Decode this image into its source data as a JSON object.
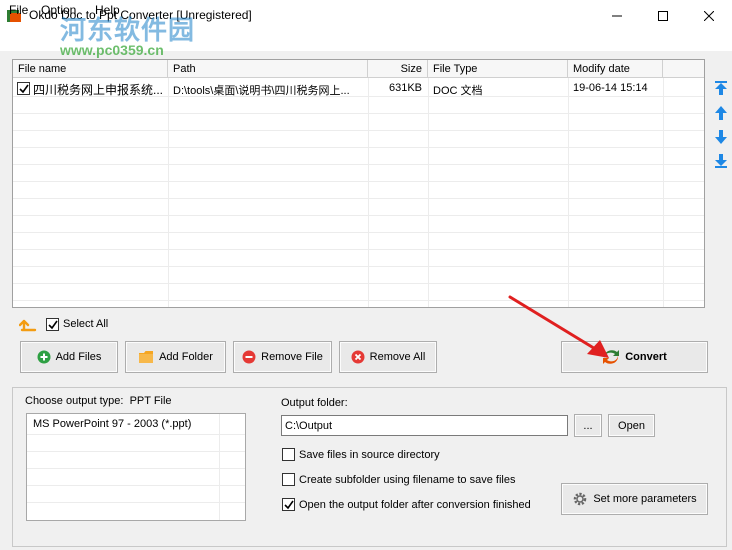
{
  "window": {
    "title": "Okdo Doc to Ppt Converter [Unregistered]",
    "watermark_main": "河东软件园",
    "watermark_url": "www.pc0359.cn"
  },
  "menu": {
    "file": "File",
    "option": "Option",
    "help": "Help"
  },
  "table": {
    "headers": {
      "name": "File name",
      "path": "Path",
      "size": "Size",
      "type": "File Type",
      "date": "Modify date"
    },
    "rows": [
      {
        "checked": true,
        "name": "四川税务网上申报系统...",
        "path": "D:\\tools\\桌面\\说明书\\四川税务网上...",
        "size": "631KB",
        "type": "DOC 文档",
        "date": "19-06-14 15:14"
      }
    ]
  },
  "controls": {
    "select_all": "Select All",
    "add_files": "Add Files",
    "add_folder": "Add Folder",
    "remove_file": "Remove File",
    "remove_all": "Remove All",
    "convert": "Convert"
  },
  "output": {
    "type_label": "Choose output type:  PPT File",
    "type_options": [
      "MS PowerPoint 97 - 2003 (*.ppt)"
    ],
    "folder_label": "Output folder:",
    "folder_value": "C:\\Output",
    "browse": "...",
    "open": "Open",
    "save_in_source": "Save files in source directory",
    "create_subfolder": "Create subfolder using filename to save files",
    "open_after": "Open the output folder after conversion finished",
    "set_params": "Set more parameters"
  },
  "colors": {
    "accent_blue": "#1e88e5",
    "arrow_red": "#e02020"
  }
}
